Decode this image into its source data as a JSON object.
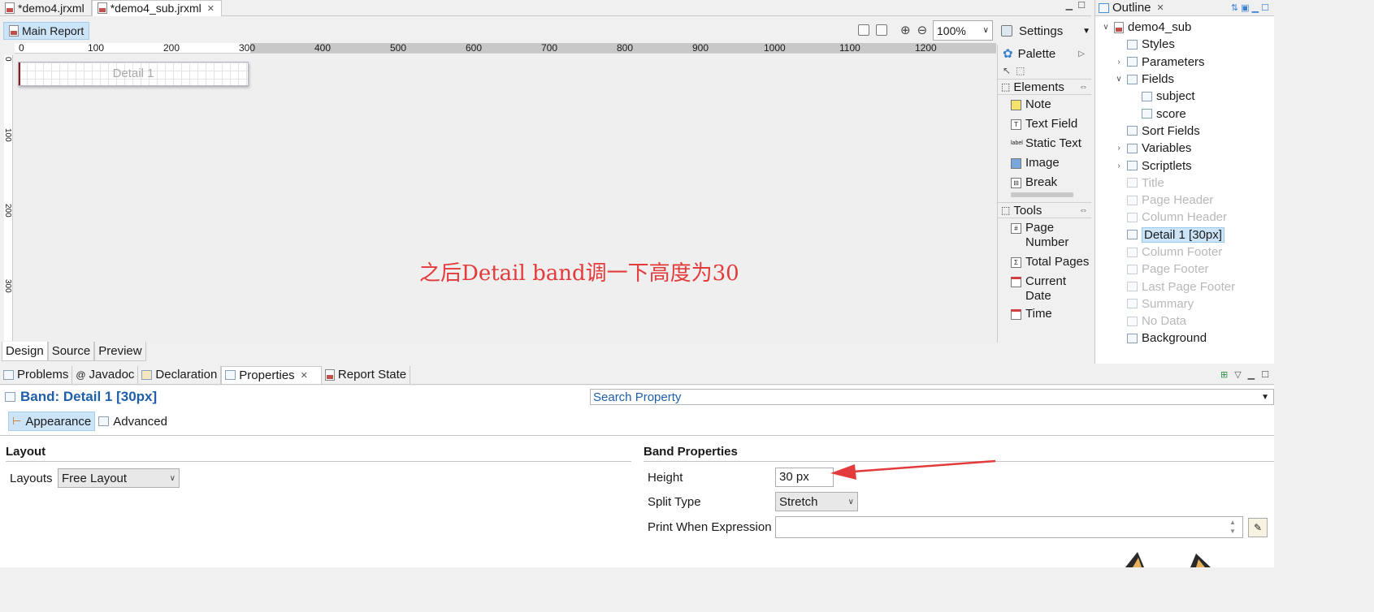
{
  "editor_tabs": [
    {
      "label": "*demo4.jrxml",
      "active": false
    },
    {
      "label": "*demo4_sub.jrxml",
      "active": true
    }
  ],
  "toolbar": {
    "main_report": "Main Report",
    "zoom": "100%",
    "settings": "Settings"
  },
  "ruler": {
    "h_ticks": [
      "0",
      "100",
      "200",
      "300",
      "400",
      "500",
      "600",
      "700",
      "800",
      "900",
      "1000",
      "1100",
      "1200"
    ],
    "v_ticks": [
      "0",
      "100",
      "200",
      "300"
    ]
  },
  "canvas": {
    "detail_label": "Detail 1",
    "annotation": "之后Detail band调一下高度为30"
  },
  "design_tabs": [
    "Design",
    "Source",
    "Preview"
  ],
  "palette": {
    "title": "Palette",
    "elements_title": "Elements",
    "elements": [
      {
        "label": "Note",
        "icon": "note-icon"
      },
      {
        "label": "Text Field",
        "icon": "text-field-icon"
      },
      {
        "label": "Static Text",
        "icon": "static-text-icon"
      },
      {
        "label": "Image",
        "icon": "image-icon"
      },
      {
        "label": "Break",
        "icon": "break-icon"
      }
    ],
    "tools_title": "Tools",
    "tools": [
      {
        "label": "Page Number",
        "icon": "page-number-icon"
      },
      {
        "label": "Total Pages",
        "icon": "total-pages-icon"
      },
      {
        "label": "Current Date",
        "icon": "current-date-icon"
      },
      {
        "label": "Time",
        "icon": "time-icon"
      }
    ]
  },
  "outline": {
    "title": "Outline",
    "root": "demo4_sub",
    "items": [
      {
        "label": "Styles",
        "level": 1,
        "twisty": "",
        "dim": false
      },
      {
        "label": "Parameters",
        "level": 1,
        "twisty": ">",
        "dim": false
      },
      {
        "label": "Fields",
        "level": 1,
        "twisty": "v",
        "dim": false
      },
      {
        "label": "subject",
        "level": 2,
        "twisty": "",
        "dim": false
      },
      {
        "label": "score",
        "level": 2,
        "twisty": "",
        "dim": false
      },
      {
        "label": "Sort Fields",
        "level": 1,
        "twisty": "",
        "dim": false
      },
      {
        "label": "Variables",
        "level": 1,
        "twisty": ">",
        "dim": false
      },
      {
        "label": "Scriptlets",
        "level": 1,
        "twisty": ">",
        "dim": false
      },
      {
        "label": "Title",
        "level": 1,
        "twisty": "",
        "dim": true
      },
      {
        "label": "Page Header",
        "level": 1,
        "twisty": "",
        "dim": true
      },
      {
        "label": "Column Header",
        "level": 1,
        "twisty": "",
        "dim": true
      },
      {
        "label": "Detail 1 [30px]",
        "level": 1,
        "twisty": "",
        "dim": false,
        "selected": true
      },
      {
        "label": "Column Footer",
        "level": 1,
        "twisty": "",
        "dim": true
      },
      {
        "label": "Page Footer",
        "level": 1,
        "twisty": "",
        "dim": true
      },
      {
        "label": "Last Page Footer",
        "level": 1,
        "twisty": "",
        "dim": true
      },
      {
        "label": "Summary",
        "level": 1,
        "twisty": "",
        "dim": true
      },
      {
        "label": "No Data",
        "level": 1,
        "twisty": "",
        "dim": true
      },
      {
        "label": "Background",
        "level": 1,
        "twisty": "",
        "dim": false
      }
    ]
  },
  "bottom_tabs": [
    {
      "label": "Problems",
      "active": false
    },
    {
      "label": "Javadoc",
      "active": false
    },
    {
      "label": "Declaration",
      "active": false
    },
    {
      "label": "Properties",
      "active": true
    },
    {
      "label": "Report State",
      "active": false
    }
  ],
  "properties": {
    "title": "Band: Detail 1 [30px]",
    "search_placeholder": "Search Property",
    "subtabs": [
      "Appearance",
      "Advanced"
    ],
    "layout_section": "Layout",
    "layouts_label": "Layouts",
    "layouts_value": "Free Layout",
    "band_section": "Band Properties",
    "height_label": "Height",
    "height_value": "30 px",
    "split_label": "Split Type",
    "split_value": "Stretch",
    "print_when_label": "Print When Expression",
    "print_when_value": ""
  },
  "colors": {
    "annotation_red": "#e33b3b",
    "selection_blue": "#cce4f7",
    "title_blue": "#1f5ea8"
  }
}
